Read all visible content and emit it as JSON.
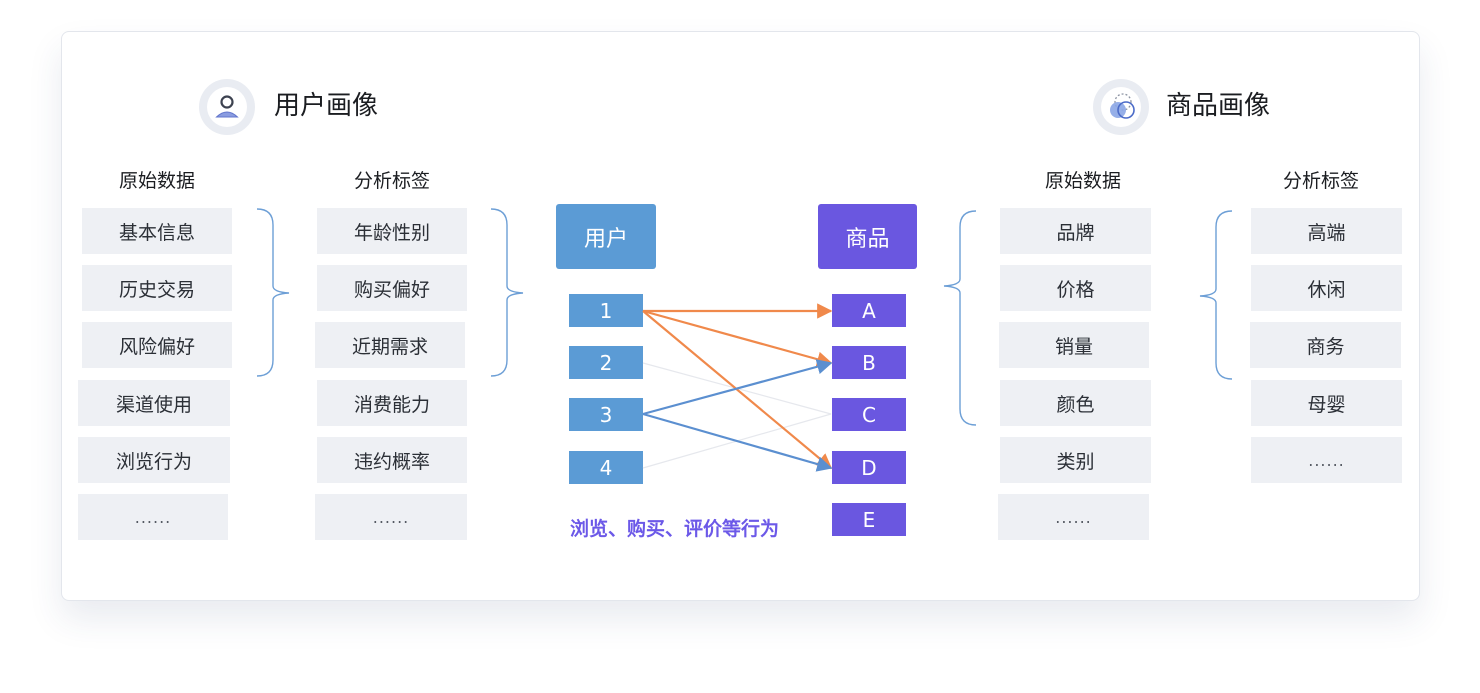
{
  "user_portrait": {
    "title": "用户画像",
    "raw_header": "原始数据",
    "raw_items": [
      "基本信息",
      "历史交易",
      "风险偏好",
      "渠道使用",
      "浏览行为",
      "......"
    ],
    "tag_header": "分析标签",
    "tag_items": [
      "年龄性别",
      "购买偏好",
      "近期需求",
      "消费能力",
      "违约概率",
      "......"
    ]
  },
  "product_portrait": {
    "title": "商品画像",
    "raw_header": "原始数据",
    "raw_items": [
      "品牌",
      "价格",
      "销量",
      "颜色",
      "类别",
      "......"
    ],
    "tag_header": "分析标签",
    "tag_items": [
      "高端",
      "休闲",
      "商务",
      "母婴",
      "......"
    ]
  },
  "center": {
    "user_label": "用户",
    "product_label": "商品",
    "users": [
      "1",
      "2",
      "3",
      "4"
    ],
    "products": [
      "A",
      "B",
      "C",
      "D",
      "E"
    ],
    "caption": "浏览、购买、评价等行为",
    "links": [
      {
        "from": "1",
        "to": "A",
        "color": "#f0894b",
        "style": "solid"
      },
      {
        "from": "1",
        "to": "B",
        "color": "#f0894b",
        "style": "solid"
      },
      {
        "from": "1",
        "to": "D",
        "color": "#f0894b",
        "style": "solid"
      },
      {
        "from": "3",
        "to": "B",
        "color": "#5b8fd0",
        "style": "solid"
      },
      {
        "from": "3",
        "to": "D",
        "color": "#5b8fd0",
        "style": "solid"
      },
      {
        "from": "2",
        "to": "C",
        "color": "#e6e8ed",
        "style": "faint"
      },
      {
        "from": "4",
        "to": "C",
        "color": "#e6e8ed",
        "style": "faint"
      }
    ]
  },
  "colors": {
    "user_blue": "#5b9bd5",
    "product_purple": "#6a57e0",
    "behavior_orange": "#f0894b",
    "behavior_blue": "#5b8fd0",
    "caption_purple": "#6c59e8",
    "cell_bg": "#eef0f4",
    "bracket": "#6d9fd6"
  },
  "icons": {
    "user": "person-icon",
    "product": "overlapping-circles-icon"
  }
}
